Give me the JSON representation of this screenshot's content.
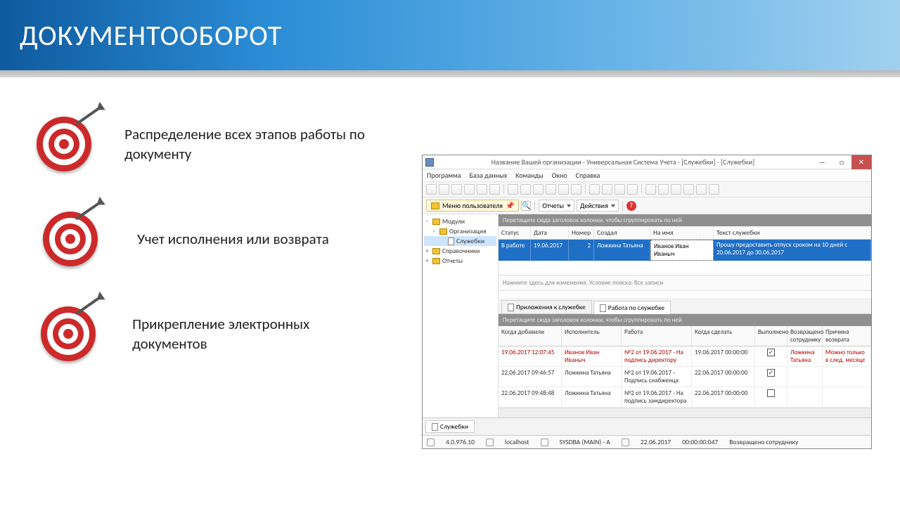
{
  "slide": {
    "title": "ДОКУМЕНТООБОРОТ",
    "bullets": [
      "Распределение всех этапов работы по документу",
      "Учет исполнения или возврата",
      "Прикрепление электронных документов"
    ]
  },
  "app": {
    "title": "Название Вашей организации - Универсальная Система Учета - [Служебки] - [Служебки]",
    "menu": [
      "Программа",
      "База данных",
      "Команды",
      "Окно",
      "Справка"
    ],
    "toolbar2": {
      "userMenu": "Меню пользователя",
      "reports": "Отчеты",
      "actions": "Действия"
    },
    "tree": {
      "root": "Модули",
      "org": "Организация",
      "memos": "Служебки",
      "refs": "Справочники",
      "reports": "Отчеты"
    },
    "groupHint": "Перетащите сюда заголовок колонки, чтобы сгруппировать по ней",
    "grid1": {
      "headers": [
        "Статус",
        "Дата",
        "Номер",
        "Создал",
        "На имя",
        "Текст служебки"
      ],
      "row": {
        "status": "В работе",
        "date": "19.06.2017",
        "num": "2",
        "author": "Ложкина Татьяна",
        "to": "Иванов Иван Иваныч",
        "text": "Прошу предоставить отпуск сроком на 10 дней с 20.06.2017 до 30.06.2017"
      }
    },
    "searchHint": "Нажмите здесь для изменения. Условие поиска: Все записи",
    "subtabs": {
      "attach": "Приложения к служебке",
      "work": "Работа по служебке"
    },
    "grid2": {
      "headers": [
        "Когда добавили",
        "Исполнитель",
        "Работа",
        "Когда сделать",
        "Выполнено",
        "Возвращено сотруднику",
        "Причина возврата"
      ],
      "rows": [
        {
          "added": "19.06.2017 12:07:45",
          "exec": "Иванов Иван Иваныч",
          "work": "№2 от 19.06.2017 - На подпись директору",
          "due": "19.06.2017 00:00:00",
          "done": true,
          "retTo": "Ложкина Татьяна",
          "reason": "Можно только в след. месяце",
          "red": true
        },
        {
          "added": "22.06.2017 09:46:57",
          "exec": "Ложкина Татьяна",
          "work": "№2 от 19.06.2017 - Подпись снабженца",
          "due": "22.06.2017 00:00:00",
          "done": true,
          "retTo": "",
          "reason": "",
          "red": false
        },
        {
          "added": "22.06.2017 09:48:48",
          "exec": "Ложкина Татьяна",
          "work": "№2 от 19.06.2017 - На подпись замдиректора",
          "due": "22.06.2017 00:00:00",
          "done": false,
          "retTo": "",
          "reason": "",
          "red": false
        }
      ]
    },
    "footerTab": "Служебки",
    "status": {
      "ver": "4.0.976.10",
      "host": "localhost",
      "user": "SYSDBA (MAIN) - А",
      "date": "22.06.2017",
      "time": "00:00:00:047",
      "state": "Возвращено сотруднику"
    }
  }
}
